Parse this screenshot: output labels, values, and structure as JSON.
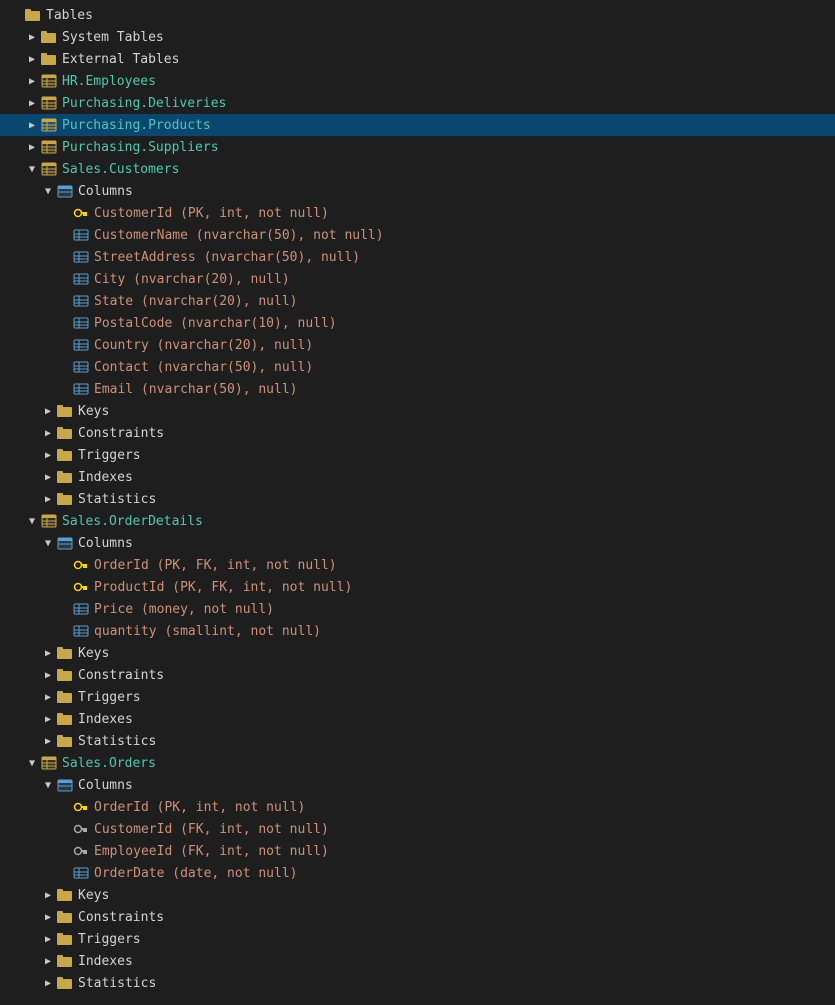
{
  "tree": {
    "selectedItem": "Purchasing.Products",
    "items": [
      {
        "id": "tables-root",
        "label": "Tables",
        "type": "folder-open",
        "level": 1,
        "expanded": true
      },
      {
        "id": "system-tables",
        "label": "System Tables",
        "type": "folder",
        "level": 2,
        "expanded": false,
        "hasArrow": true
      },
      {
        "id": "external-tables",
        "label": "External Tables",
        "type": "folder",
        "level": 2,
        "expanded": false,
        "hasArrow": true
      },
      {
        "id": "hr-employees",
        "label": "HR.Employees",
        "type": "table",
        "level": 2,
        "expanded": false,
        "hasArrow": true
      },
      {
        "id": "purchasing-deliveries",
        "label": "Purchasing.Deliveries",
        "type": "table",
        "level": 2,
        "expanded": false,
        "hasArrow": true
      },
      {
        "id": "purchasing-products",
        "label": "Purchasing.Products",
        "type": "table",
        "level": 2,
        "expanded": false,
        "hasArrow": true,
        "selected": true
      },
      {
        "id": "purchasing-suppliers",
        "label": "Purchasing.Suppliers",
        "type": "table",
        "level": 2,
        "expanded": false,
        "hasArrow": true
      },
      {
        "id": "sales-customers",
        "label": "Sales.Customers",
        "type": "table",
        "level": 2,
        "expanded": true,
        "hasArrow": true
      },
      {
        "id": "sales-customers-columns",
        "label": "Columns",
        "type": "columns-folder",
        "level": 3,
        "expanded": true,
        "hasArrow": true
      },
      {
        "id": "col-customerid",
        "label": "CustomerId (PK, int, not null)",
        "type": "col-pk",
        "level": 4,
        "hasArrow": false
      },
      {
        "id": "col-customername",
        "label": "CustomerName (nvarchar(50), not null)",
        "type": "col",
        "level": 4,
        "hasArrow": false
      },
      {
        "id": "col-streetaddress",
        "label": "StreetAddress (nvarchar(50), null)",
        "type": "col",
        "level": 4,
        "hasArrow": false
      },
      {
        "id": "col-city",
        "label": "City (nvarchar(20), null)",
        "type": "col",
        "level": 4,
        "hasArrow": false
      },
      {
        "id": "col-state",
        "label": "State (nvarchar(20), null)",
        "type": "col",
        "level": 4,
        "hasArrow": false
      },
      {
        "id": "col-postalcode",
        "label": "PostalCode (nvarchar(10), null)",
        "type": "col",
        "level": 4,
        "hasArrow": false
      },
      {
        "id": "col-country",
        "label": "Country (nvarchar(20), null)",
        "type": "col",
        "level": 4,
        "hasArrow": false
      },
      {
        "id": "col-contact",
        "label": "Contact (nvarchar(50), null)",
        "type": "col",
        "level": 4,
        "hasArrow": false
      },
      {
        "id": "col-email",
        "label": "Email (nvarchar(50), null)",
        "type": "col",
        "level": 4,
        "hasArrow": false
      },
      {
        "id": "sc-keys",
        "label": "Keys",
        "type": "folder",
        "level": 3,
        "expanded": false,
        "hasArrow": true
      },
      {
        "id": "sc-constraints",
        "label": "Constraints",
        "type": "folder",
        "level": 3,
        "expanded": false,
        "hasArrow": true
      },
      {
        "id": "sc-triggers",
        "label": "Triggers",
        "type": "folder",
        "level": 3,
        "expanded": false,
        "hasArrow": true
      },
      {
        "id": "sc-indexes",
        "label": "Indexes",
        "type": "folder",
        "level": 3,
        "expanded": false,
        "hasArrow": true
      },
      {
        "id": "sc-statistics",
        "label": "Statistics",
        "type": "folder",
        "level": 3,
        "expanded": false,
        "hasArrow": true
      },
      {
        "id": "sales-orderdetails",
        "label": "Sales.OrderDetails",
        "type": "table",
        "level": 2,
        "expanded": true,
        "hasArrow": true
      },
      {
        "id": "sod-columns",
        "label": "Columns",
        "type": "columns-folder",
        "level": 3,
        "expanded": true,
        "hasArrow": true
      },
      {
        "id": "col-orderid",
        "label": "OrderId (PK, FK, int, not null)",
        "type": "col-pk",
        "level": 4,
        "hasArrow": false
      },
      {
        "id": "col-productid",
        "label": "ProductId (PK, FK, int, not null)",
        "type": "col-pk",
        "level": 4,
        "hasArrow": false
      },
      {
        "id": "col-price",
        "label": "Price (money, not null)",
        "type": "col",
        "level": 4,
        "hasArrow": false
      },
      {
        "id": "col-quantity",
        "label": "quantity (smallint, not null)",
        "type": "col",
        "level": 4,
        "hasArrow": false
      },
      {
        "id": "sod-keys",
        "label": "Keys",
        "type": "folder",
        "level": 3,
        "expanded": false,
        "hasArrow": true
      },
      {
        "id": "sod-constraints",
        "label": "Constraints",
        "type": "folder",
        "level": 3,
        "expanded": false,
        "hasArrow": true
      },
      {
        "id": "sod-triggers",
        "label": "Triggers",
        "type": "folder",
        "level": 3,
        "expanded": false,
        "hasArrow": true
      },
      {
        "id": "sod-indexes",
        "label": "Indexes",
        "type": "folder",
        "level": 3,
        "expanded": false,
        "hasArrow": true
      },
      {
        "id": "sod-statistics",
        "label": "Statistics",
        "type": "folder",
        "level": 3,
        "expanded": false,
        "hasArrow": true
      },
      {
        "id": "sales-orders",
        "label": "Sales.Orders",
        "type": "table",
        "level": 2,
        "expanded": true,
        "hasArrow": true
      },
      {
        "id": "so-columns",
        "label": "Columns",
        "type": "columns-folder",
        "level": 3,
        "expanded": true,
        "hasArrow": true
      },
      {
        "id": "col-so-orderid",
        "label": "OrderId (PK, int, not null)",
        "type": "col-pk",
        "level": 4,
        "hasArrow": false
      },
      {
        "id": "col-so-customerid",
        "label": "CustomerId (FK, int, not null)",
        "type": "col-fk",
        "level": 4,
        "hasArrow": false
      },
      {
        "id": "col-so-employeeid",
        "label": "EmployeeId (FK, int, not null)",
        "type": "col-fk",
        "level": 4,
        "hasArrow": false
      },
      {
        "id": "col-so-orderdate",
        "label": "OrderDate (date, not null)",
        "type": "col",
        "level": 4,
        "hasArrow": false
      },
      {
        "id": "so-keys",
        "label": "Keys",
        "type": "folder",
        "level": 3,
        "expanded": false,
        "hasArrow": true
      },
      {
        "id": "so-constraints",
        "label": "Constraints",
        "type": "folder",
        "level": 3,
        "expanded": false,
        "hasArrow": true
      },
      {
        "id": "so-triggers",
        "label": "Triggers",
        "type": "folder",
        "level": 3,
        "expanded": false,
        "hasArrow": true
      },
      {
        "id": "so-indexes",
        "label": "Indexes",
        "type": "folder",
        "level": 3,
        "expanded": false,
        "hasArrow": true
      },
      {
        "id": "so-statistics",
        "label": "Statistics",
        "type": "folder",
        "level": 3,
        "expanded": false,
        "hasArrow": true
      }
    ]
  }
}
